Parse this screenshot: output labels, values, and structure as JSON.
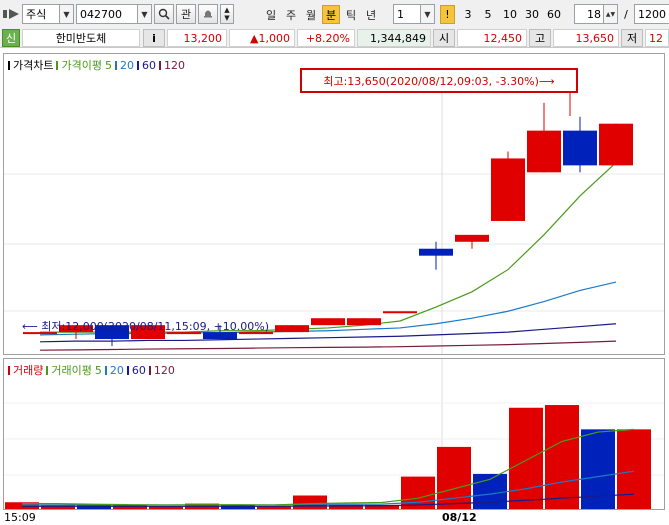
{
  "toolbar": {
    "market_select": "주식",
    "code_input": "042700",
    "search_icon": "magnifier-icon",
    "buttons": [
      "관"
    ],
    "periods": [
      "일",
      "주",
      "월",
      "분",
      "틱",
      "년"
    ],
    "active_period": "분",
    "interval_select": "1",
    "interval_presets": [
      "1",
      "3",
      "5",
      "10",
      "30",
      "60"
    ],
    "highlight_preset": "!",
    "count_value": "18",
    "count_sep": "/",
    "count_total": "1200"
  },
  "quote": {
    "badge": "신",
    "stock_name": "한미반도체",
    "info_button": "i",
    "price": "13,200",
    "change": "▲1,000",
    "change_pct": "+8.20%",
    "volume": "1,344,849",
    "open_label": "시",
    "open": "12,450",
    "high_label": "고",
    "high": "13,650",
    "low_label": "저",
    "low": "12"
  },
  "price_legend": {
    "title": "가격차트",
    "ma_label": "가격이평",
    "ma_5": "5",
    "ma_20": "20",
    "ma_60": "60",
    "ma_120": "120"
  },
  "volume_legend": {
    "title": "거래량",
    "ma_label": "거래이평",
    "ma_5": "5",
    "ma_20": "20",
    "ma_60": "60",
    "ma_120": "120"
  },
  "annotations": {
    "high_note": "최고:13,650(2020/08/12,09:03, -3.30%)⟶",
    "low_note": "⟵ 최저:12,000(2020/08/11,15:09, +10.00%)"
  },
  "x_axis": {
    "ticks": [
      "15:09",
      "08/12"
    ]
  },
  "colors": {
    "up": "#e00000",
    "down": "#0022bb",
    "ma5": "#4a9a1a",
    "ma20": "#1a7ac8",
    "ma60": "#1a1a8a",
    "ma120": "#7a1a3a",
    "accent": "#f6c33c"
  },
  "chart_data": [
    {
      "type": "candlestick",
      "price_range": [
        11900,
        13800
      ],
      "candles": [
        {
          "open": 12000,
          "high": 12000,
          "low": 12000,
          "close": 12000
        },
        {
          "open": 12000,
          "high": 12050,
          "low": 11950,
          "close": 12050
        },
        {
          "open": 12050,
          "high": 12050,
          "low": 11900,
          "close": 11950
        },
        {
          "open": 11950,
          "high": 12050,
          "low": 11950,
          "close": 12050
        },
        {
          "open": 12000,
          "high": 12000,
          "low": 12000,
          "close": 12000
        },
        {
          "open": 12000,
          "high": 12050,
          "low": 11950,
          "close": 11950
        },
        {
          "open": 12000,
          "high": 12000,
          "low": 12000,
          "close": 12000
        },
        {
          "open": 12000,
          "high": 12050,
          "low": 12000,
          "close": 12050
        },
        {
          "open": 12050,
          "high": 12100,
          "low": 12050,
          "close": 12100
        },
        {
          "open": 12050,
          "high": 12100,
          "low": 12050,
          "close": 12100
        },
        {
          "open": 12150,
          "high": 12150,
          "low": 12150,
          "close": 12150
        },
        {
          "open": 12600,
          "high": 12650,
          "low": 12450,
          "close": 12550
        },
        {
          "open": 12650,
          "high": 12700,
          "low": 12600,
          "close": 12700
        },
        {
          "open": 12800,
          "high": 13300,
          "low": 12800,
          "close": 13250
        },
        {
          "open": 13150,
          "high": 13650,
          "low": 13150,
          "close": 13450
        },
        {
          "open": 13450,
          "high": 13550,
          "low": 13150,
          "close": 13200
        },
        {
          "open": 13200,
          "high": 13500,
          "low": 13200,
          "close": 13500
        }
      ],
      "ma5": [
        12000,
        12000,
        12000,
        12000,
        12000,
        12010,
        12010,
        12020,
        12030,
        12050,
        12080,
        12180,
        12290,
        12450,
        12700,
        12980,
        13220
      ],
      "ma20": [
        11980,
        11985,
        11990,
        11990,
        11995,
        11995,
        12000,
        12005,
        12010,
        12020,
        12030,
        12060,
        12100,
        12150,
        12220,
        12300,
        12360
      ],
      "ma60": [
        11930,
        11935,
        11935,
        11940,
        11940,
        11945,
        11950,
        11955,
        11960,
        11965,
        11970,
        11980,
        11990,
        12000,
        12020,
        12040,
        12060
      ],
      "ma120": [
        11870,
        11872,
        11875,
        11878,
        11880,
        11882,
        11885,
        11888,
        11890,
        11892,
        11895,
        11900,
        11905,
        11910,
        11918,
        11926,
        11935
      ]
    },
    {
      "type": "bar",
      "value_range": [
        0,
        100
      ],
      "volumes": [
        5,
        3,
        3,
        3,
        2,
        4,
        3,
        2,
        10,
        3,
        3,
        24,
        46,
        26,
        75,
        77,
        59,
        59
      ],
      "directions": [
        "up",
        "up",
        "down",
        "up",
        "up",
        "up",
        "down",
        "up",
        "up",
        "up",
        "up",
        "up",
        "up",
        "down",
        "up",
        "up",
        "down",
        "up"
      ],
      "ma5": [
        4,
        4,
        3.5,
        3.2,
        3,
        3.2,
        3.2,
        3,
        4,
        4.5,
        4.8,
        8,
        15,
        22,
        36,
        50,
        57,
        59
      ],
      "ma20": [
        3,
        3,
        3,
        3,
        3,
        3,
        3,
        3,
        3.5,
        3.5,
        3.6,
        5,
        8,
        11,
        15,
        20,
        24,
        28
      ],
      "ma60": [
        2,
        2,
        2,
        2,
        2,
        2,
        2,
        2,
        2.2,
        2.3,
        2.4,
        3,
        4,
        5,
        6.5,
        8,
        9.5,
        11
      ]
    }
  ]
}
